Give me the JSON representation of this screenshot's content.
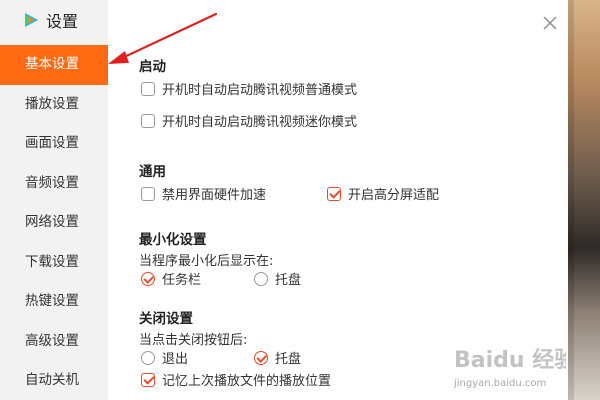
{
  "window": {
    "title": "设置"
  },
  "sidebar": {
    "items": [
      {
        "label": "基本设置",
        "active": true
      },
      {
        "label": "播放设置",
        "active": false
      },
      {
        "label": "画面设置",
        "active": false
      },
      {
        "label": "音频设置",
        "active": false
      },
      {
        "label": "网络设置",
        "active": false
      },
      {
        "label": "下载设置",
        "active": false
      },
      {
        "label": "热键设置",
        "active": false
      },
      {
        "label": "高级设置",
        "active": false
      },
      {
        "label": "自动关机",
        "active": false
      }
    ]
  },
  "startup": {
    "title": "启动",
    "normal_mode": {
      "label": "开机时自动启动腾讯视频普通模式",
      "checked": false
    },
    "mini_mode": {
      "label": "开机时自动启动腾讯视频迷你模式",
      "checked": false
    }
  },
  "general": {
    "title": "通用",
    "disable_hw_accel": {
      "label": "禁用界面硬件加速",
      "checked": false
    },
    "hidpi": {
      "label": "开启高分屏适配",
      "checked": true
    }
  },
  "minimize": {
    "title": "最小化设置",
    "prompt": "当程序最小化后显示在:",
    "taskbar": {
      "label": "任务栏",
      "selected": true
    },
    "tray": {
      "label": "托盘",
      "selected": false
    }
  },
  "close": {
    "title": "关闭设置",
    "prompt": "当点击关闭按钮后:",
    "exit": {
      "label": "退出",
      "selected": false
    },
    "tray": {
      "label": "托盘",
      "selected": true
    },
    "remember_position": {
      "label": "记忆上次播放文件的播放位置",
      "checked": true
    }
  },
  "watermark": {
    "logo_text": "Baidu 经验",
    "url": "jingyan.baidu.com"
  },
  "colors": {
    "accent": "#ff6a13",
    "check": "#e64a2e",
    "annotation_arrow": "#e02020",
    "sidebar_bg": "#f2f2f2"
  },
  "icons": {
    "app_logo": "tencent-video-logo-icon",
    "close": "close-icon"
  }
}
